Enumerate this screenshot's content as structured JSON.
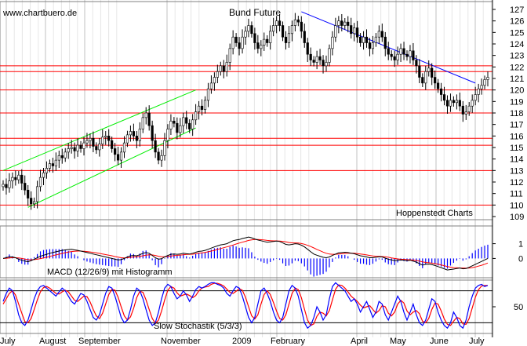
{
  "header": {
    "watermark": "www.chartbuero.de"
  },
  "chart_data": {
    "type": "candlestick",
    "title": "Bund Future",
    "source_label": "Hoppenstedt Charts",
    "grid": true,
    "colors": {
      "background": "#ffffff",
      "grid": "#c0c0c0",
      "candles": "#000000",
      "support_resistance": "#ff0000",
      "trend_channel": "#00ee00",
      "downtrend": "#0000ff",
      "macd_line": "#000000",
      "signal_line": "#ff0000",
      "histogram": "#0000ff",
      "stoch_k": "#0000ff",
      "stoch_d": "#ff0000"
    },
    "x_axis": {
      "months": [
        "July",
        "August",
        "September",
        "November",
        "2009",
        "February",
        "April",
        "May",
        "June",
        "July"
      ]
    },
    "price_panel": {
      "ylim": [
        109,
        127
      ],
      "yticks": [
        109,
        110,
        111,
        112,
        113,
        114,
        115,
        116,
        117,
        118,
        119,
        120,
        121,
        122,
        123,
        124,
        125,
        126,
        127
      ],
      "closes": [
        111.8,
        111.5,
        112.1,
        112.4,
        112.2,
        112.6,
        111.9,
        111.3,
        110.6,
        110.1,
        110.3,
        111.6,
        112.4,
        112.8,
        113.2,
        113.6,
        113.4,
        113.9,
        114.3,
        114.1,
        114.6,
        114.9,
        115.0,
        114.7,
        115.2,
        114.9,
        115.4,
        115.6,
        115.8,
        115.1,
        114.8,
        115.3,
        115.9,
        116.0,
        115.6,
        114.9,
        114.4,
        113.9,
        114.6,
        115.4,
        116.1,
        116.4,
        116.0,
        115.6,
        116.6,
        117.6,
        118.0,
        116.9,
        115.6,
        114.6,
        113.9,
        114.3,
        115.6,
        116.6,
        117.3,
        117.1,
        116.3,
        116.9,
        117.6,
        117.1,
        116.6,
        117.4,
        118.1,
        118.6,
        118.3,
        119.1,
        120.1,
        120.6,
        121.1,
        121.6,
        122.1,
        121.6,
        122.4,
        123.6,
        124.6,
        124.1,
        123.6,
        124.6,
        125.1,
        125.6,
        124.9,
        124.1,
        123.6,
        123.9,
        124.4,
        124.1,
        125.1,
        125.6,
        126.0,
        125.6,
        124.6,
        124.1,
        124.9,
        125.6,
        126.1,
        125.9,
        125.1,
        124.1,
        123.1,
        122.6,
        122.4,
        122.9,
        122.6,
        122.1,
        122.4,
        123.6,
        124.6,
        125.6,
        126.0,
        125.6,
        125.9,
        125.6,
        124.9,
        125.4,
        124.6,
        124.1,
        124.6,
        124.1,
        123.6,
        124.1,
        124.6,
        125.1,
        124.6,
        123.6,
        123.1,
        122.9,
        122.6,
        123.1,
        123.6,
        123.1,
        122.9,
        123.4,
        122.6,
        122.1,
        121.1,
        120.6,
        121.6,
        121.9,
        121.1,
        120.6,
        120.1,
        119.6,
        119.1,
        118.6,
        119.1,
        118.9,
        119.1,
        118.6,
        117.9,
        118.1,
        118.6,
        119.1,
        119.6,
        120.1,
        120.4,
        120.9,
        121.1
      ],
      "support_resistance_levels": [
        110.0,
        113.0,
        115.2,
        115.8,
        118.0,
        120.0,
        121.6,
        122.1
      ],
      "trend_channel_upper": [
        [
          0,
          113.0
        ],
        [
          62,
          120.0
        ]
      ],
      "trend_channel_lower": [
        [
          8,
          109.8
        ],
        [
          62,
          116.7
        ]
      ],
      "downtrend_line": [
        [
          96,
          126.8
        ],
        [
          152,
          120.6
        ]
      ]
    },
    "macd_panel": {
      "label": "MACD (12/26/9) mit Histogramm",
      "ylim": [
        -1.2,
        2.2
      ],
      "yticks": [
        1,
        0
      ],
      "macd": [
        0.0,
        0.05,
        0.12,
        0.1,
        0.05,
        -0.05,
        -0.12,
        -0.18,
        -0.22,
        -0.15,
        -0.05,
        0.05,
        0.15,
        0.22,
        0.28,
        0.35,
        0.4,
        0.45,
        0.5,
        0.55,
        0.58,
        0.6,
        0.62,
        0.58,
        0.55,
        0.5,
        0.45,
        0.4,
        0.35,
        0.3,
        0.25,
        0.2,
        0.15,
        0.1,
        0.05,
        0.0,
        -0.05,
        -0.1,
        -0.08,
        0.0,
        0.1,
        0.18,
        0.2,
        0.18,
        0.25,
        0.35,
        0.4,
        0.35,
        0.2,
        0.05,
        -0.05,
        -0.02,
        0.1,
        0.2,
        0.28,
        0.3,
        0.28,
        0.3,
        0.35,
        0.32,
        0.3,
        0.35,
        0.42,
        0.48,
        0.5,
        0.55,
        0.62,
        0.7,
        0.78,
        0.85,
        0.92,
        0.95,
        1.0,
        1.1,
        1.2,
        1.25,
        1.28,
        1.35,
        1.4,
        1.45,
        1.4,
        1.32,
        1.25,
        1.2,
        1.15,
        1.1,
        1.12,
        1.15,
        1.18,
        1.15,
        1.05,
        0.95,
        0.92,
        0.95,
        1.0,
        0.98,
        0.9,
        0.78,
        0.62,
        0.45,
        0.3,
        0.22,
        0.15,
        0.08,
        0.05,
        0.1,
        0.2,
        0.3,
        0.38,
        0.4,
        0.42,
        0.4,
        0.35,
        0.32,
        0.25,
        0.18,
        0.15,
        0.1,
        0.05,
        0.05,
        0.08,
        0.12,
        0.1,
        0.02,
        -0.05,
        -0.1,
        -0.15,
        -0.12,
        -0.1,
        -0.12,
        -0.15,
        -0.12,
        -0.18,
        -0.25,
        -0.35,
        -0.45,
        -0.4,
        -0.38,
        -0.42,
        -0.48,
        -0.55,
        -0.62,
        -0.7,
        -0.78,
        -0.75,
        -0.72,
        -0.68,
        -0.65,
        -0.7,
        -0.68,
        -0.6,
        -0.5,
        -0.4,
        -0.3,
        -0.2,
        -0.1,
        0.0
      ],
      "signal": [
        0.0,
        0.01,
        0.03,
        0.05,
        0.05,
        0.03,
        0.0,
        -0.04,
        -0.08,
        -0.09,
        -0.08,
        -0.05,
        -0.01,
        0.03,
        0.08,
        0.14,
        0.19,
        0.24,
        0.29,
        0.34,
        0.39,
        0.43,
        0.47,
        0.49,
        0.5,
        0.5,
        0.49,
        0.47,
        0.44,
        0.41,
        0.38,
        0.34,
        0.3,
        0.26,
        0.22,
        0.18,
        0.13,
        0.09,
        0.05,
        0.04,
        0.05,
        0.07,
        0.1,
        0.12,
        0.14,
        0.18,
        0.22,
        0.25,
        0.24,
        0.2,
        0.15,
        0.11,
        0.11,
        0.13,
        0.16,
        0.19,
        0.21,
        0.23,
        0.25,
        0.27,
        0.28,
        0.29,
        0.32,
        0.35,
        0.38,
        0.41,
        0.45,
        0.5,
        0.55,
        0.61,
        0.67,
        0.73,
        0.78,
        0.84,
        0.91,
        0.98,
        1.04,
        1.1,
        1.16,
        1.22,
        1.26,
        1.28,
        1.28,
        1.27,
        1.25,
        1.22,
        1.2,
        1.19,
        1.19,
        1.18,
        1.16,
        1.12,
        1.08,
        1.06,
        1.05,
        1.04,
        1.01,
        0.96,
        0.89,
        0.81,
        0.71,
        0.61,
        0.52,
        0.43,
        0.35,
        0.3,
        0.28,
        0.28,
        0.3,
        0.32,
        0.34,
        0.35,
        0.35,
        0.35,
        0.33,
        0.3,
        0.27,
        0.24,
        0.2,
        0.17,
        0.15,
        0.14,
        0.13,
        0.11,
        0.08,
        0.04,
        0.0,
        -0.03,
        -0.05,
        -0.06,
        -0.08,
        -0.09,
        -0.11,
        -0.14,
        -0.18,
        -0.23,
        -0.27,
        -0.29,
        -0.32,
        -0.35,
        -0.39,
        -0.44,
        -0.49,
        -0.55,
        -0.59,
        -0.62,
        -0.63,
        -0.64,
        -0.65,
        -0.66,
        -0.65,
        -0.62,
        -0.58,
        -0.52,
        -0.46,
        -0.39,
        -0.31
      ]
    },
    "stochastic_panel": {
      "label": "Slow Stochastik (5/3/3)",
      "ylim": [
        0,
        100
      ],
      "yticks": [
        50
      ],
      "reference_levels": [
        80,
        20
      ],
      "k": [
        60,
        75,
        85,
        80,
        60,
        35,
        20,
        15,
        25,
        45,
        65,
        80,
        88,
        90,
        85,
        80,
        75,
        70,
        78,
        85,
        80,
        70,
        60,
        55,
        65,
        75,
        72,
        60,
        45,
        30,
        25,
        35,
        55,
        75,
        88,
        85,
        70,
        50,
        30,
        20,
        25,
        45,
        70,
        85,
        80,
        65,
        45,
        25,
        15,
        20,
        40,
        65,
        85,
        92,
        88,
        75,
        65,
        70,
        80,
        72,
        60,
        70,
        82,
        88,
        85,
        88,
        92,
        95,
        95,
        92,
        90,
        85,
        75,
        70,
        80,
        88,
        85,
        70,
        50,
        30,
        20,
        30,
        55,
        80,
        85,
        75,
        60,
        40,
        25,
        20,
        30,
        55,
        80,
        90,
        85,
        70,
        45,
        20,
        10,
        15,
        30,
        50,
        40,
        25,
        35,
        65,
        88,
        95,
        90,
        85,
        80,
        70,
        60,
        65,
        55,
        40,
        50,
        60,
        45,
        30,
        40,
        60,
        55,
        35,
        25,
        40,
        55,
        70,
        60,
        40,
        25,
        40,
        55,
        35,
        20,
        15,
        25,
        45,
        65,
        60,
        40,
        25,
        15,
        10,
        20,
        40,
        30,
        15,
        10,
        25,
        50,
        70,
        85,
        90,
        92,
        88,
        90
      ],
      "d": [
        55,
        65,
        75,
        80,
        72,
        55,
        38,
        22,
        20,
        28,
        45,
        63,
        78,
        86,
        88,
        85,
        80,
        75,
        74,
        78,
        81,
        78,
        70,
        62,
        60,
        65,
        70,
        69,
        59,
        45,
        33,
        28,
        38,
        55,
        73,
        83,
        81,
        68,
        50,
        33,
        25,
        31,
        47,
        67,
        79,
        77,
        63,
        45,
        28,
        19,
        25,
        42,
        63,
        81,
        88,
        85,
        76,
        70,
        72,
        74,
        71,
        67,
        71,
        80,
        85,
        87,
        88,
        92,
        94,
        94,
        92,
        89,
        83,
        77,
        75,
        79,
        84,
        81,
        68,
        50,
        33,
        27,
        35,
        55,
        73,
        80,
        73,
        58,
        42,
        28,
        25,
        35,
        55,
        75,
        85,
        82,
        67,
        45,
        25,
        15,
        18,
        32,
        40,
        38,
        33,
        43,
        63,
        83,
        91,
        90,
        85,
        78,
        70,
        65,
        60,
        53,
        48,
        50,
        52,
        45,
        38,
        43,
        52,
        50,
        38,
        33,
        40,
        55,
        62,
        57,
        42,
        35,
        40,
        43,
        37,
        23,
        20,
        28,
        45,
        57,
        55,
        42,
        27,
        17,
        15,
        23,
        30,
        28,
        18,
        17,
        28,
        48,
        68,
        82,
        89,
        90,
        90
      ]
    }
  }
}
